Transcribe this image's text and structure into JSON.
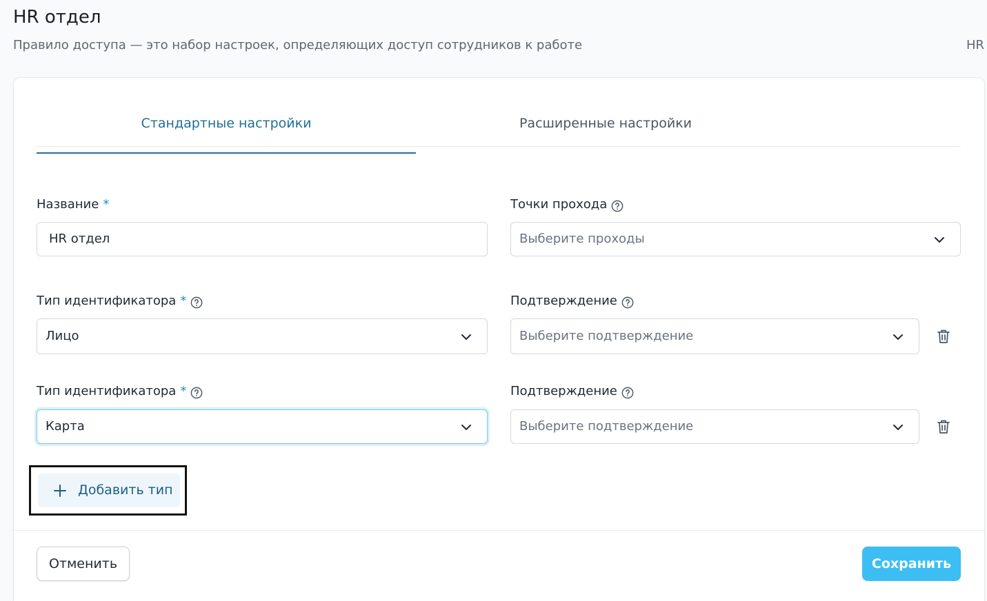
{
  "header": {
    "title": "HR отдел",
    "subtitle": "Правило доступа — это набор настроек, определяющих доступ сотрудников к работе",
    "corner_text": "HR"
  },
  "tabs": [
    {
      "label": "Стандартные настройки",
      "active": true
    },
    {
      "label": "Расширенные настройки",
      "active": false
    }
  ],
  "form": {
    "name": {
      "label": "Название",
      "required_mark": "*",
      "value": "HR отдел"
    },
    "access_points": {
      "label": "Точки прохода",
      "placeholder": "Выберите проходы",
      "icon": "chevron-down-icon"
    },
    "identifiers": [
      {
        "type_label": "Тип идентификатора",
        "required_mark": "*",
        "type_value": "Лицо",
        "confirm_label": "Подтверждение",
        "confirm_placeholder": "Выберите подтверждение"
      },
      {
        "type_label": "Тип идентификатора",
        "required_mark": "*",
        "type_value": "Карта",
        "confirm_label": "Подтверждение",
        "confirm_placeholder": "Выберите подтверждение"
      }
    ],
    "add_type_label": "Добавить тип"
  },
  "footer": {
    "cancel_label": "Отменить",
    "save_label": "Сохранить"
  },
  "colors": {
    "accent": "#1e6f96",
    "save_button": "#3dbef2",
    "required": "#1f8cc0",
    "focus_border": "#7fc7ea"
  }
}
